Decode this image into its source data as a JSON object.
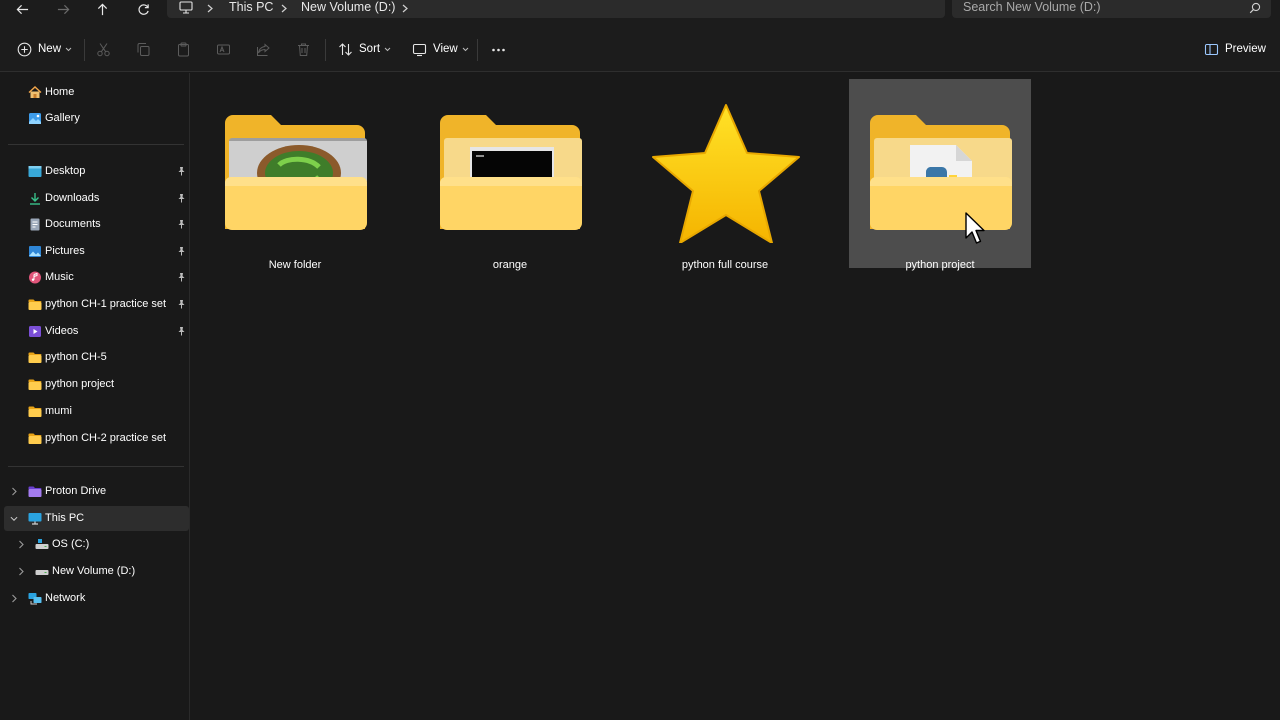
{
  "addressbar": {
    "back_icon": "arrow-left-icon",
    "forward_icon": "arrow-right-icon",
    "up_icon": "arrow-up-icon",
    "refresh_icon": "refresh-icon",
    "breadcrumb": [
      "This PC",
      "New Volume (D:)"
    ],
    "search_placeholder": "Search New Volume (D:)"
  },
  "toolbar": {
    "new_label": "New",
    "sort_label": "Sort",
    "view_label": "View",
    "preview_label": "Preview"
  },
  "sidebar": {
    "quick": [
      {
        "label": "Home",
        "icon": "home-icon"
      },
      {
        "label": "Gallery",
        "icon": "gallery-icon"
      }
    ],
    "pinned": [
      {
        "label": "Desktop",
        "icon": "desktop-icon",
        "pinned": true
      },
      {
        "label": "Downloads",
        "icon": "download-icon",
        "pinned": true
      },
      {
        "label": "Documents",
        "icon": "document-icon",
        "pinned": true
      },
      {
        "label": "Pictures",
        "icon": "pictures-icon",
        "pinned": true
      },
      {
        "label": "Music",
        "icon": "music-icon",
        "pinned": true
      },
      {
        "label": "python CH-1 practice set",
        "icon": "folder-icon",
        "pinned": true
      },
      {
        "label": "Videos",
        "icon": "videos-icon",
        "pinned": true
      },
      {
        "label": "python CH-5",
        "icon": "folder-icon",
        "pinned": false
      },
      {
        "label": "python project",
        "icon": "folder-icon",
        "pinned": false
      },
      {
        "label": "mumi",
        "icon": "folder-icon",
        "pinned": false
      },
      {
        "label": "python CH-2 practice set",
        "icon": "folder-icon",
        "pinned": false
      }
    ],
    "tree": [
      {
        "label": "Proton Drive",
        "icon": "proton-drive-icon",
        "expanded": false,
        "selected": false
      },
      {
        "label": "This PC",
        "icon": "this-pc-icon",
        "expanded": true,
        "selected": true
      },
      {
        "label": "OS (C:)",
        "icon": "drive-c-icon",
        "expanded": false,
        "selected": false
      },
      {
        "label": "New Volume (D:)",
        "icon": "drive-d-icon",
        "expanded": false,
        "selected": false
      },
      {
        "label": "Network",
        "icon": "network-icon",
        "expanded": false,
        "selected": false
      }
    ]
  },
  "items": [
    {
      "name": "New folder",
      "icon": "folder-with-photo-icon",
      "selected": false
    },
    {
      "name": "orange",
      "icon": "folder-with-terminal-icon",
      "selected": false
    },
    {
      "name": "python full course",
      "icon": "star-icon",
      "selected": false
    },
    {
      "name": "python project",
      "icon": "folder-with-python-file-icon",
      "selected": true
    }
  ],
  "colors": {
    "background": "#191919",
    "folder_back": "#f0b429",
    "folder_front": "#ffd565",
    "star": "#f9c80e",
    "selection": "#4d4d4d"
  }
}
